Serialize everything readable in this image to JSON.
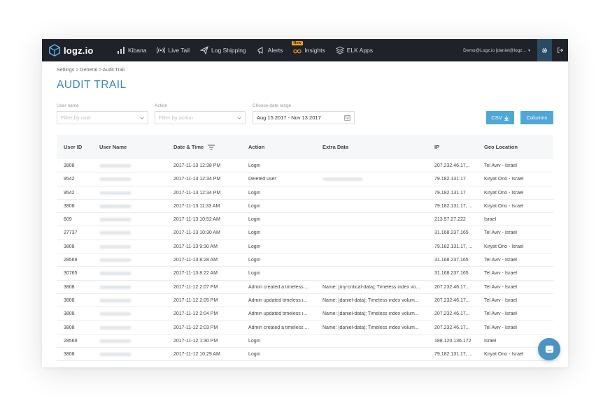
{
  "brand": {
    "name": "logz.io"
  },
  "nav": {
    "items": [
      {
        "label": "Kibana",
        "icon": "bar-chart-icon"
      },
      {
        "label": "Live Tail",
        "icon": "broadcast-icon"
      },
      {
        "label": "Log Shipping",
        "icon": "paper-plane-icon"
      },
      {
        "label": "Alerts",
        "icon": "megaphone-icon"
      },
      {
        "label": "Insights",
        "icon": "binoculars-icon",
        "badge": "New"
      },
      {
        "label": "ELK Apps",
        "icon": "layers-icon"
      }
    ],
    "user": "Demo@Logz.io [daniel@logz...",
    "accent": "#2b4a63"
  },
  "breadcrumb": "Settings > General > Audit Trail",
  "page_title": "AUDIT TRAIL",
  "filters": {
    "user_label": "User name",
    "user_placeholder": "Filter by user",
    "action_label": "Action",
    "action_placeholder": "Filter by action",
    "date_label": "Choose date range",
    "date_value": "Aug 15 2017 - Nov 13 2017"
  },
  "buttons": {
    "csv": "CSV",
    "columns": "Columns"
  },
  "table": {
    "headers": [
      "User ID",
      "User Name",
      "Date & Time",
      "Action",
      "Extra Data",
      "IP",
      "Geo Location"
    ],
    "rows": [
      {
        "user_id": "3808",
        "datetime": "2017-11-13 12:38 PM",
        "action": "Login",
        "extra": "",
        "ip": "207.232.46.17...",
        "geo": "Tel Aviv - Israel"
      },
      {
        "user_id": "9542",
        "datetime": "2017-11-13 12:34 PM",
        "action": "Deleted user",
        "extra": "",
        "ip": "79.182.131.17",
        "geo": "Kiryat Ono - Israel"
      },
      {
        "user_id": "9542",
        "datetime": "2017-11-13 12:34 PM",
        "action": "Login",
        "extra": "",
        "ip": "79.182.131.17",
        "geo": "Kiryat Ono - Israel"
      },
      {
        "user_id": "3808",
        "datetime": "2017-11-13 11:33 AM",
        "action": "Login",
        "extra": "",
        "ip": "79.182.131.17, ...",
        "geo": "Kiryat Ono - Israel"
      },
      {
        "user_id": "609",
        "datetime": "2017-11-13 10:52 AM",
        "action": "Login",
        "extra": "",
        "ip": "213.57.27.222",
        "geo": "Israel"
      },
      {
        "user_id": "27737",
        "datetime": "2017-11-13 10:30 AM",
        "action": "Login",
        "extra": "",
        "ip": "31.168.237.165",
        "geo": "Tel Aviv - Israel"
      },
      {
        "user_id": "3808",
        "datetime": "2017-11-13 9:30 AM",
        "action": "Login",
        "extra": "",
        "ip": "79.182.131.17, ...",
        "geo": "Kiryat Ono - Israel"
      },
      {
        "user_id": "28566",
        "datetime": "2017-11-13 8:28 AM",
        "action": "Login",
        "extra": "",
        "ip": "31.168.237.165",
        "geo": "Tel Aviv - Israel"
      },
      {
        "user_id": "30765",
        "datetime": "2017-11-13 8:22 AM",
        "action": "Login",
        "extra": "",
        "ip": "31.168.237.165",
        "geo": "Tel Aviv - Israel"
      },
      {
        "user_id": "3808",
        "datetime": "2017-11-12 2:07 PM",
        "action": "Admin created a timeless ...",
        "extra": "Name: [my-critical-data]; Timeless index vo...",
        "ip": "207.232.46.17...",
        "geo": "Tel Aviv - Israel"
      },
      {
        "user_id": "3808",
        "datetime": "2017-11-12 2:05 PM",
        "action": "Admin updated timeless i...",
        "extra": "Name: [daniel-data]; Timeless index volum...",
        "ip": "207.232.46.17...",
        "geo": "Tel Aviv - Israel"
      },
      {
        "user_id": "3808",
        "datetime": "2017-11-12 2:04 PM",
        "action": "Admin updated timeless i...",
        "extra": "Name: [daniel-data]; Timeless index volum...",
        "ip": "207.232.46.17...",
        "geo": "Tel Aviv - Israel"
      },
      {
        "user_id": "3808",
        "datetime": "2017-11-12 2:03 PM",
        "action": "Admin created a timeless ...",
        "extra": "Name: [daniel-data]; Timeless index volum...",
        "ip": "207.232.46.17...",
        "geo": "Tel Aviv - Israel"
      },
      {
        "user_id": "28566",
        "datetime": "2017-11-12 1:30 PM",
        "action": "Login",
        "extra": "",
        "ip": "188.120.136.172",
        "geo": "Israel"
      },
      {
        "user_id": "3808",
        "datetime": "2017-11-12 10:29 AM",
        "action": "Login",
        "extra": "",
        "ip": "79.182.131.17, ...",
        "geo": "Kiryat Ono - Israel"
      }
    ]
  },
  "colors": {
    "title": "#3b87b5",
    "button": "#4fa7d6",
    "navbar": "#1f2329",
    "chat": "#4b93c2"
  }
}
